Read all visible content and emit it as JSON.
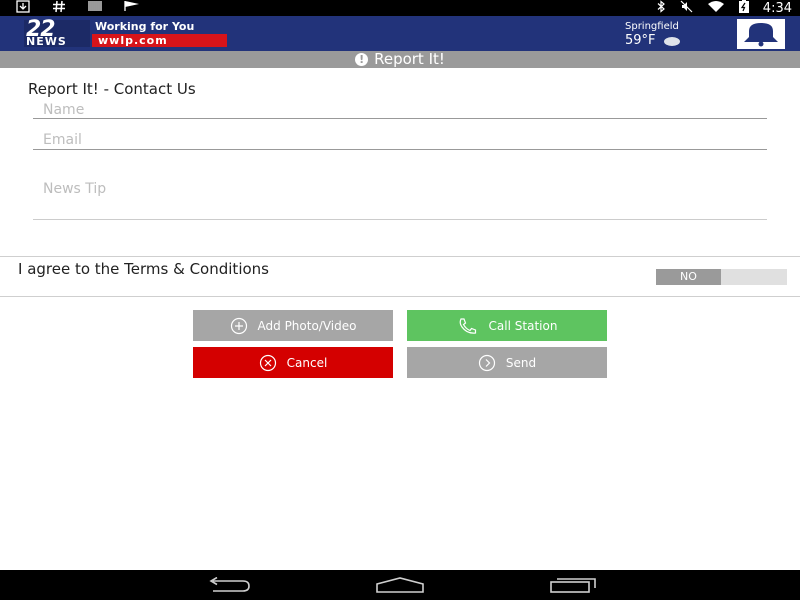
{
  "status_bar": {
    "time": "4:34",
    "left_icons": [
      "download-icon",
      "hash-icon",
      "barcode-icon",
      "flag-icon"
    ],
    "right_icons": [
      "bluetooth-icon",
      "mute-icon",
      "wifi-icon",
      "battery-icon"
    ]
  },
  "header": {
    "logo_number": "22",
    "logo_news": "NEWS",
    "logo_tagline": "Working for You",
    "logo_site": "wwlp.com",
    "weather_city": "Springfield",
    "weather_temp": "59°F",
    "weather_icon": "moon-icon",
    "alert_icon": "bell-icon"
  },
  "title_bar": {
    "title": "Report It!",
    "icon": "exclamation-icon"
  },
  "form": {
    "heading": "Report It! - Contact Us",
    "name_placeholder": "Name",
    "name_value": "",
    "email_placeholder": "Email",
    "email_value": "",
    "tip_placeholder": "News Tip",
    "tip_value": ""
  },
  "terms": {
    "label": "I agree to the Terms & Conditions",
    "toggle_state": "NO"
  },
  "buttons": {
    "add_media": "Add Photo/Video",
    "call_station": "Call Station",
    "cancel": "Cancel",
    "send": "Send"
  },
  "colors": {
    "header_bg": "#22337a",
    "logo_red": "#d7141a",
    "title_bar_bg": "#9a9a9a",
    "call_green": "#5ec460",
    "cancel_red": "#d40000",
    "neutral_gray": "#a6a6a6"
  },
  "navbar": {
    "icons": [
      "back-icon",
      "home-icon",
      "recents-icon"
    ]
  }
}
